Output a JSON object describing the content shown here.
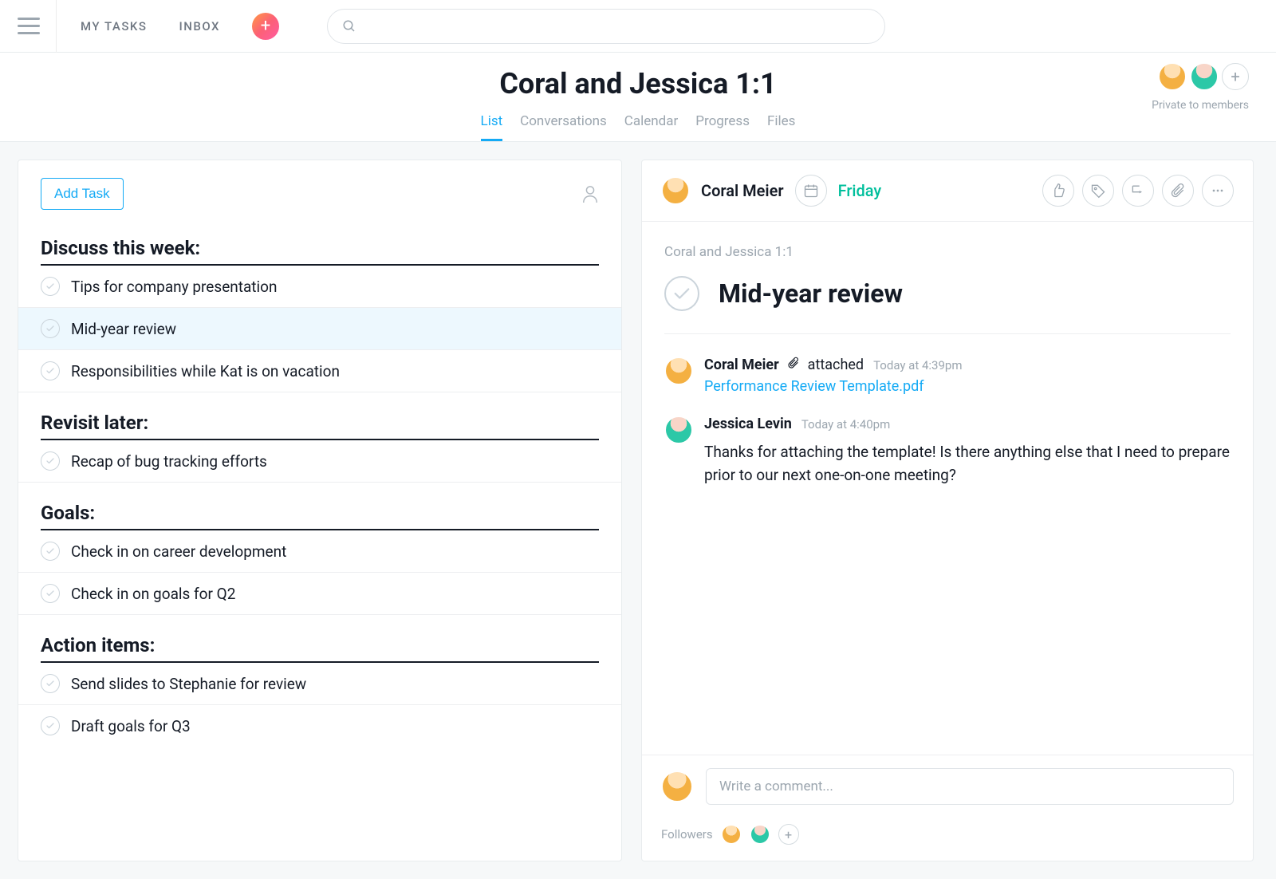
{
  "topbar": {
    "nav": {
      "my_tasks": "MY TASKS",
      "inbox": "INBOX"
    },
    "search_placeholder": ""
  },
  "header": {
    "title": "Coral and Jessica 1:1",
    "tabs": {
      "list": "List",
      "conversations": "Conversations",
      "calendar": "Calendar",
      "progress": "Progress",
      "files": "Files"
    },
    "privacy": "Private to members"
  },
  "left": {
    "add_task": "Add Task",
    "sections": [
      {
        "title": "Discuss this week:",
        "tasks": [
          {
            "title": "Tips for company presentation",
            "selected": false
          },
          {
            "title": "Mid-year review",
            "selected": true
          },
          {
            "title": "Responsibilities while Kat is on vacation",
            "selected": false
          }
        ]
      },
      {
        "title": "Revisit later:",
        "tasks": [
          {
            "title": "Recap of bug tracking efforts",
            "selected": false
          }
        ]
      },
      {
        "title": "Goals:",
        "tasks": [
          {
            "title": "Check in on career development",
            "selected": false
          },
          {
            "title": "Check in on goals for Q2",
            "selected": false
          }
        ]
      },
      {
        "title": "Action items:",
        "tasks": [
          {
            "title": "Send slides to Stephanie for review",
            "selected": false
          },
          {
            "title": "Draft goals for Q3",
            "selected": false
          }
        ]
      }
    ]
  },
  "detail": {
    "assignee": "Coral Meier",
    "due": "Friday",
    "breadcrumb": "Coral and Jessica 1:1",
    "title": "Mid-year review",
    "stories": [
      {
        "author": "Coral Meier",
        "verb": "attached",
        "time": "Today at 4:39pm",
        "link": "Performance Review Template.pdf",
        "text": "",
        "avatar": "coral",
        "has_clip": true
      },
      {
        "author": "Jessica Levin",
        "verb": "",
        "time": "Today at 4:40pm",
        "link": "",
        "text": "Thanks for attaching the template!\n\nIs there anything else that I need to prepare prior to our next one-on-one meeting?",
        "avatar": "jessica",
        "has_clip": false
      }
    ],
    "comment_placeholder": "Write a comment...",
    "followers_label": "Followers"
  }
}
